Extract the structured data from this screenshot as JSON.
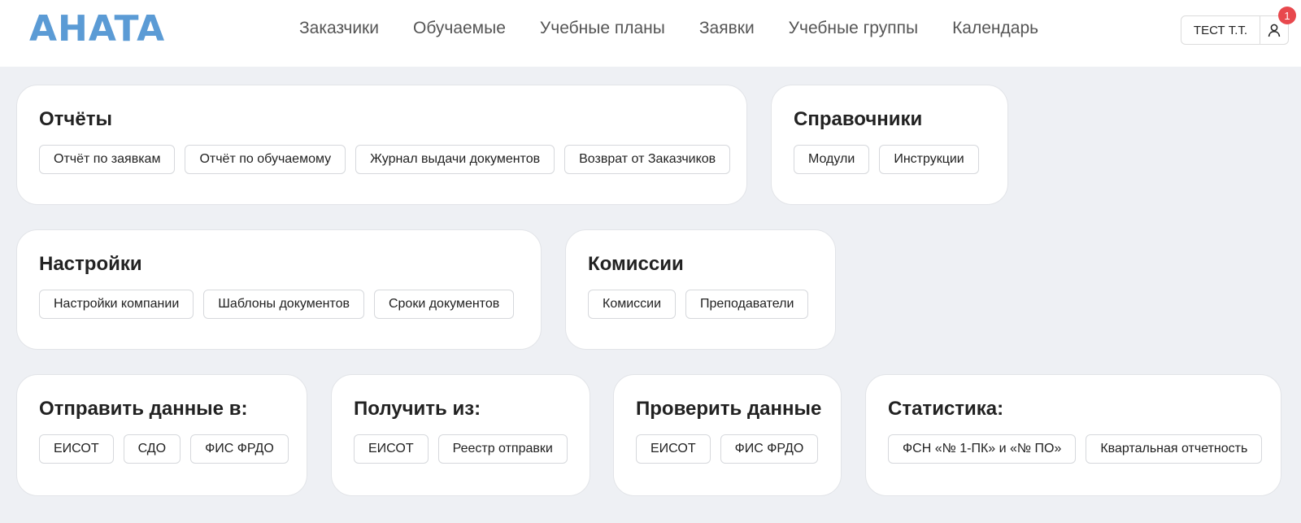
{
  "logo": "AHATA",
  "nav": [
    "Заказчики",
    "Обучаемые",
    "Учебные планы",
    "Заявки",
    "Учебные группы",
    "Календарь"
  ],
  "user": {
    "name": "ТЕСТ Т.Т.",
    "notifications": "1",
    "icon": "user-icon"
  },
  "cards": {
    "reports": {
      "title": "Отчёты",
      "buttons": [
        "Отчёт по заявкам",
        "Отчёт по обучаемому",
        "Журнал выдачи документов",
        "Возврат от Заказчиков"
      ]
    },
    "reference": {
      "title": "Справочники",
      "buttons": [
        "Модули",
        "Инструкции"
      ]
    },
    "settings": {
      "title": "Настройки",
      "buttons": [
        "Настройки компании",
        "Шаблоны документов",
        "Сроки документов"
      ]
    },
    "commissions": {
      "title": "Комиссии",
      "buttons": [
        "Комиссии",
        "Преподаватели"
      ]
    },
    "send": {
      "title": "Отправить данные в:",
      "buttons": [
        "ЕИСОТ",
        "СДО",
        "ФИС ФРДО"
      ]
    },
    "receive": {
      "title": "Получить из:",
      "buttons": [
        "ЕИСОТ",
        "Реестр отправки"
      ]
    },
    "check": {
      "title": "Проверить данные",
      "buttons": [
        "ЕИСОТ",
        "ФИС ФРДО"
      ]
    },
    "stats": {
      "title": "Статистика:",
      "buttons": [
        "ФСН «№ 1-ПК» и «№ ПО»",
        "Квартальная отчетность"
      ]
    }
  },
  "colors": {
    "logo": "#5b9bd5",
    "badge": "#e8484d",
    "background": "#eef0f4"
  }
}
